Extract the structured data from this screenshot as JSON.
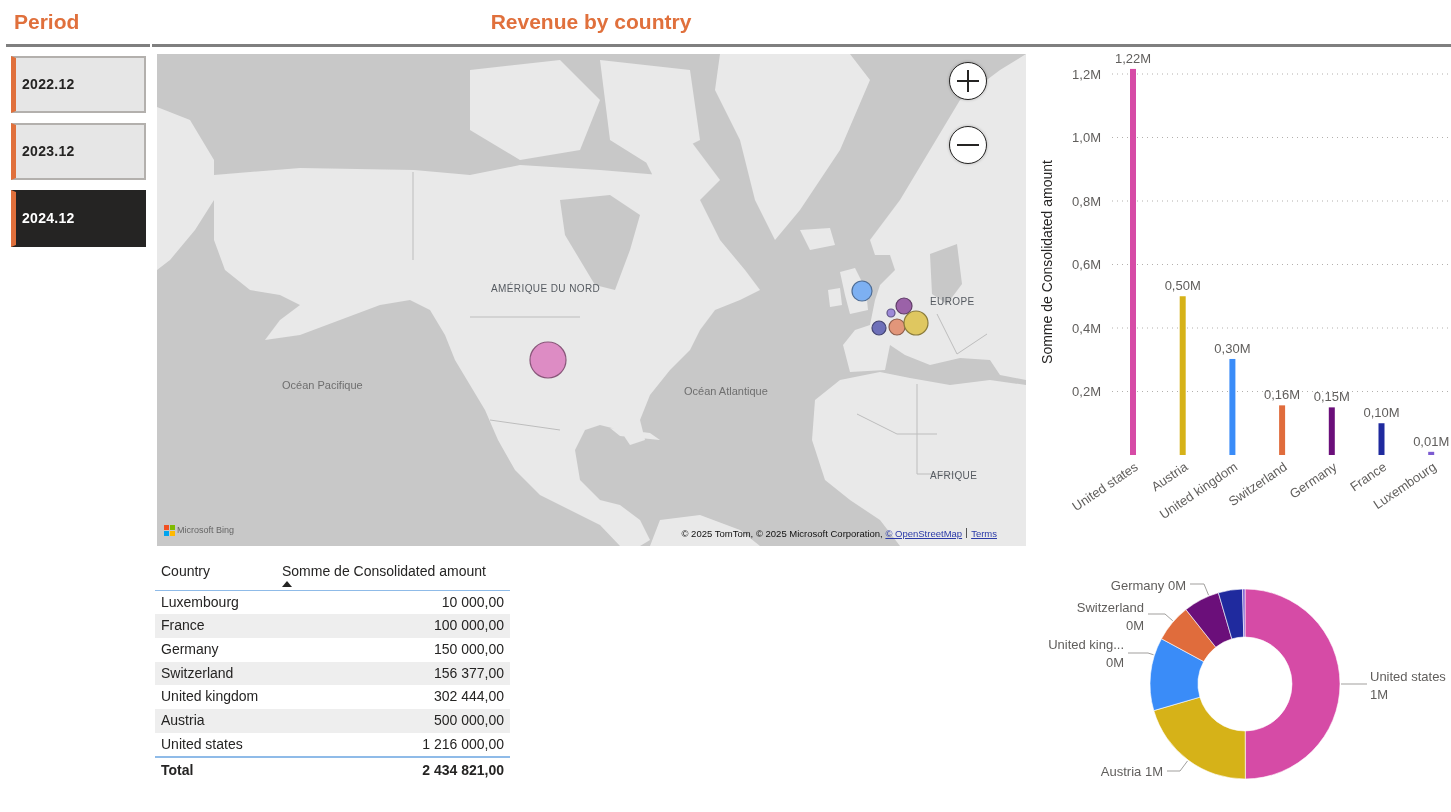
{
  "slicer": {
    "title": "Period",
    "items": [
      {
        "label": "2022.12",
        "selected": false
      },
      {
        "label": "2023.12",
        "selected": false
      },
      {
        "label": "2024.12",
        "selected": true
      }
    ]
  },
  "map": {
    "title": "Revenue by country",
    "labels": [
      {
        "text": "AMÉRIQUE DU NORD",
        "kind": "continent"
      },
      {
        "text": "Océan Pacifique",
        "kind": "ocean"
      },
      {
        "text": "Océan Atlantique",
        "kind": "ocean"
      },
      {
        "text": "EUROPE",
        "kind": "continent"
      },
      {
        "text": "AFRIQUE",
        "kind": "continent"
      }
    ],
    "bubbles": [
      {
        "color": "#dd8cc4"
      },
      {
        "color": "#7db0f2"
      },
      {
        "color": "#9b62a8"
      },
      {
        "color": "#9d8ad8"
      },
      {
        "color": "#6e70b9"
      },
      {
        "color": "#e2967a"
      },
      {
        "color": "#dfc760"
      }
    ],
    "logo_text": "Microsoft Bing",
    "attribution": {
      "text": "© 2025 TomTom, © 2025 Microsoft Corporation,",
      "links": [
        "© OpenStreetMap",
        "Terms"
      ]
    }
  },
  "table": {
    "columns": [
      {
        "label": "Country",
        "sorted": false
      },
      {
        "label": "Somme de Consolidated amount",
        "sorted": true
      }
    ],
    "rows": [
      {
        "country": "Luxembourg",
        "amount": "10 000,00"
      },
      {
        "country": "France",
        "amount": "100 000,00"
      },
      {
        "country": "Germany",
        "amount": "150 000,00"
      },
      {
        "country": "Switzerland",
        "amount": "156 377,00"
      },
      {
        "country": "United kingdom",
        "amount": "302 444,00"
      },
      {
        "country": "Austria",
        "amount": "500 000,00"
      },
      {
        "country": "United states",
        "amount": "1 216 000,00"
      }
    ],
    "total": {
      "label": "Total",
      "amount": "2 434 821,00"
    }
  },
  "bar_chart": {
    "chart_data": {
      "type": "bar",
      "ylabel": "Somme de Consolidated amount",
      "categories": [
        "United states",
        "Austria",
        "United kingdom",
        "Switzerland",
        "Germany",
        "France",
        "Luxembourg"
      ],
      "values": [
        1216000,
        500000,
        302444,
        156377,
        150000,
        100000,
        10000
      ],
      "colors": [
        "#d64ba6",
        "#d6b218",
        "#3a8cf8",
        "#e06c3c",
        "#6b0f7a",
        "#1f2a9e",
        "#7c5bd1"
      ],
      "ylim": [
        0,
        1220000
      ],
      "yticks": [
        {
          "value": 200000,
          "label": "0,2M"
        },
        {
          "value": 400000,
          "label": "0,4M"
        },
        {
          "value": 600000,
          "label": "0,6M"
        },
        {
          "value": 800000,
          "label": "0,8M"
        },
        {
          "value": 1000000,
          "label": "1,0M"
        },
        {
          "value": 1200000,
          "label": "1,2M"
        }
      ],
      "grid": true,
      "value_labels": [
        "1,22M",
        "0,50M",
        "0,30M",
        "0,16M",
        "0,15M",
        "0,10M",
        "0,01M"
      ]
    }
  },
  "donut_chart": {
    "chart_data": {
      "type": "donut",
      "categories": [
        "United states",
        "Austria",
        "United king...",
        "Switzerland",
        "Germany",
        null,
        null
      ],
      "values": [
        49.94,
        20.54,
        12.42,
        6.42,
        6.16,
        4.11,
        0.41
      ],
      "colors": [
        "#d64ba6",
        "#d6b218",
        "#3a8cf8",
        "#e06c3c",
        "#6b0f7a",
        "#1f2a9e",
        "#7c5bd1"
      ]
    },
    "slice_value_texts": [
      "1M",
      "1M",
      "0M",
      "0M",
      "0M"
    ]
  }
}
